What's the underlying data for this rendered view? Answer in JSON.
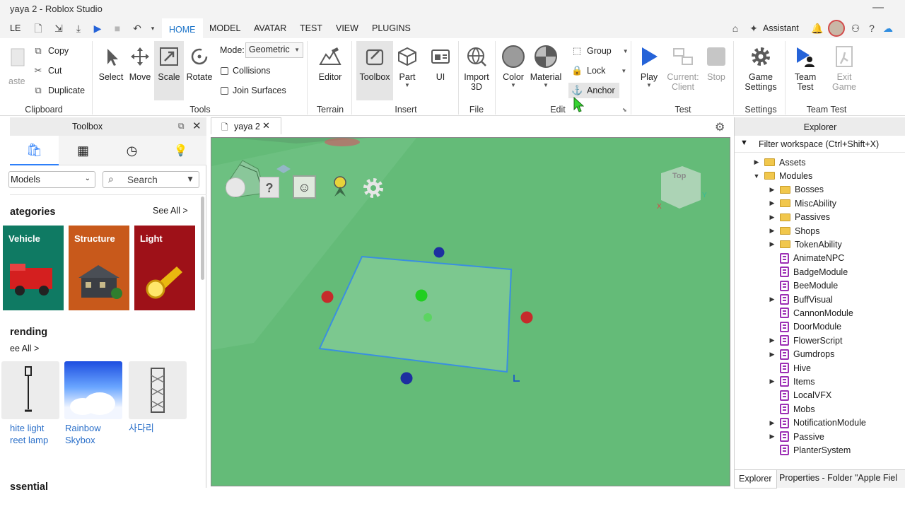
{
  "window": {
    "title": "yaya 2 - Roblox Studio",
    "minimize_glyph": "—"
  },
  "menubar": {
    "file_label": "LE",
    "tabs": [
      "HOME",
      "MODEL",
      "AVATAR",
      "TEST",
      "VIEW",
      "PLUGINS"
    ],
    "active_tab": "HOME",
    "assistant_label": "Assistant"
  },
  "ribbon": {
    "clipboard": {
      "paste": "aste",
      "copy": "Copy",
      "cut": "Cut",
      "duplicate": "Duplicate",
      "label": "Clipboard"
    },
    "tools": {
      "select": "Select",
      "move": "Move",
      "scale": "Scale",
      "rotate": "Rotate",
      "mode_label": "Mode:",
      "mode_value": "Geometric",
      "collisions": "Collisions",
      "join_surfaces": "Join Surfaces",
      "label": "Tools"
    },
    "terrain": {
      "editor": "Editor",
      "label": "Terrain"
    },
    "insert": {
      "toolbox": "Toolbox",
      "part": "Part",
      "ui": "UI",
      "label": "Insert"
    },
    "file": {
      "import_line1": "Import",
      "import_line2": "3D",
      "label": "File"
    },
    "edit": {
      "color": "Color",
      "material": "Material",
      "group": "Group",
      "lock": "Lock",
      "anchor": "Anchor",
      "label": "Edit"
    },
    "test": {
      "play": "Play",
      "current_line1": "Current:",
      "current_line2": "Client",
      "stop": "Stop",
      "label": "Test"
    },
    "settings": {
      "game_line1": "Game",
      "game_line2": "Settings",
      "label": "Settings"
    },
    "team_test": {
      "team_line1": "Team",
      "team_line2": "Test",
      "exit_line1": "Exit",
      "exit_line2": "Game",
      "label": "Team Test"
    }
  },
  "toolbox": {
    "title": "Toolbox",
    "category_select": "Models",
    "search_placeholder": "Search",
    "categories_heading": "ategories",
    "see_all": "See All >",
    "cards": [
      {
        "label": "Vehicle",
        "color": "#0f7a63"
      },
      {
        "label": "Structure",
        "color": "#c8591b"
      },
      {
        "label": "Light",
        "color": "#9e1118"
      }
    ],
    "trending_heading": "rending",
    "trending_see_all": "ee All >",
    "items": [
      {
        "line1": "hite light",
        "line2": "reet lamp"
      },
      {
        "line1": "Rainbow",
        "line2": "Skybox"
      },
      {
        "line1": "사다리",
        "line2": ""
      }
    ],
    "essential_heading": "ssential"
  },
  "document_tab": {
    "label": "yaya 2"
  },
  "viewport": {
    "cube_label": "Top",
    "axis_x": "X",
    "axis_y": "Y",
    "floor_color": "#64bb78"
  },
  "explorer": {
    "title": "Explorer",
    "filter_placeholder": "Filter workspace (Ctrl+Shift+X)",
    "tree": [
      {
        "label": "Assets",
        "type": "folder",
        "depth": 0,
        "arrow": "right"
      },
      {
        "label": "Modules",
        "type": "folder",
        "depth": 0,
        "arrow": "down"
      },
      {
        "label": "Bosses",
        "type": "folder",
        "depth": 1,
        "arrow": "right"
      },
      {
        "label": "MiscAbility",
        "type": "folder",
        "depth": 1,
        "arrow": "right"
      },
      {
        "label": "Passives",
        "type": "folder",
        "depth": 1,
        "arrow": "right"
      },
      {
        "label": "Shops",
        "type": "folder",
        "depth": 1,
        "arrow": "right"
      },
      {
        "label": "TokenAbility",
        "type": "folder",
        "depth": 1,
        "arrow": "right"
      },
      {
        "label": "AnimateNPC",
        "type": "module",
        "depth": 1,
        "arrow": ""
      },
      {
        "label": "BadgeModule",
        "type": "module",
        "depth": 1,
        "arrow": ""
      },
      {
        "label": "BeeModule",
        "type": "module",
        "depth": 1,
        "arrow": ""
      },
      {
        "label": "BuffVisual",
        "type": "module",
        "depth": 1,
        "arrow": "right"
      },
      {
        "label": "CannonModule",
        "type": "module",
        "depth": 1,
        "arrow": ""
      },
      {
        "label": "DoorModule",
        "type": "module",
        "depth": 1,
        "arrow": ""
      },
      {
        "label": "FlowerScript",
        "type": "module",
        "depth": 1,
        "arrow": "right"
      },
      {
        "label": "Gumdrops",
        "type": "module",
        "depth": 1,
        "arrow": "right"
      },
      {
        "label": "Hive",
        "type": "module",
        "depth": 1,
        "arrow": ""
      },
      {
        "label": "Items",
        "type": "module",
        "depth": 1,
        "arrow": "right"
      },
      {
        "label": "LocalVFX",
        "type": "module",
        "depth": 1,
        "arrow": ""
      },
      {
        "label": "Mobs",
        "type": "module",
        "depth": 1,
        "arrow": ""
      },
      {
        "label": "NotificationModule",
        "type": "module",
        "depth": 1,
        "arrow": "right"
      },
      {
        "label": "Passive",
        "type": "module",
        "depth": 1,
        "arrow": "right"
      },
      {
        "label": "PlanterSystem",
        "type": "module",
        "depth": 1,
        "arrow": ""
      }
    ],
    "bottom_tabs": [
      "Explorer",
      "Properties - Folder \"Apple Fiel"
    ]
  }
}
